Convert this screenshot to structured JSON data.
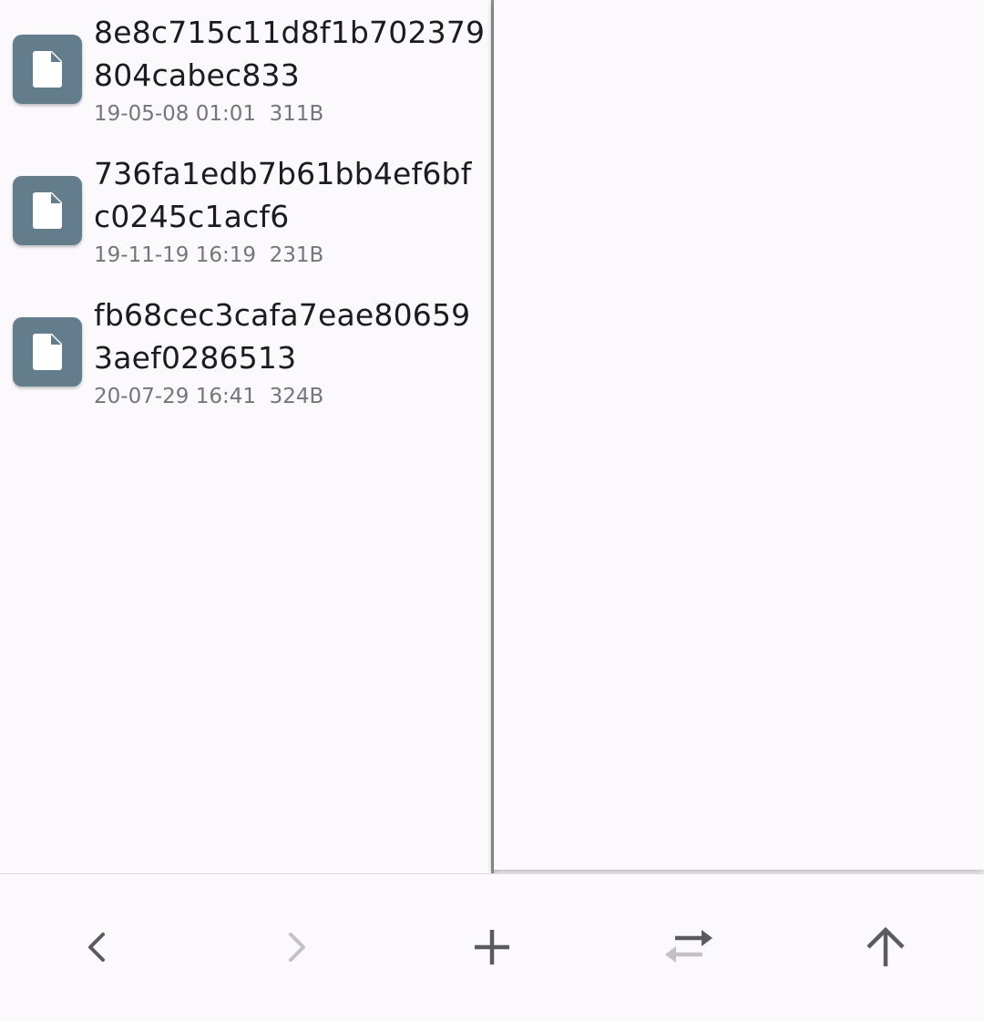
{
  "files": [
    {
      "name": "8e8c715c11d8f1b702379804cabec833",
      "date": "19-05-08 01:01",
      "size": "311B"
    },
    {
      "name": "736fa1edb7b61bb4ef6bfc0245c1acf6",
      "date": "19-11-19 16:19",
      "size": "231B"
    },
    {
      "name": "fb68cec3cafa7eae806593aef0286513",
      "date": "20-07-29 16:41",
      "size": "324B"
    }
  ],
  "icons": {
    "file": "file-icon",
    "back": "chevron-left-icon",
    "forward": "chevron-right-icon",
    "add": "plus-icon",
    "swap": "swap-arrows-icon",
    "up": "arrow-up-icon"
  },
  "colors": {
    "icon_bg": "#637d8d",
    "active_icon": "#5b5a5e",
    "disabled_icon": "#c3c1c6"
  }
}
